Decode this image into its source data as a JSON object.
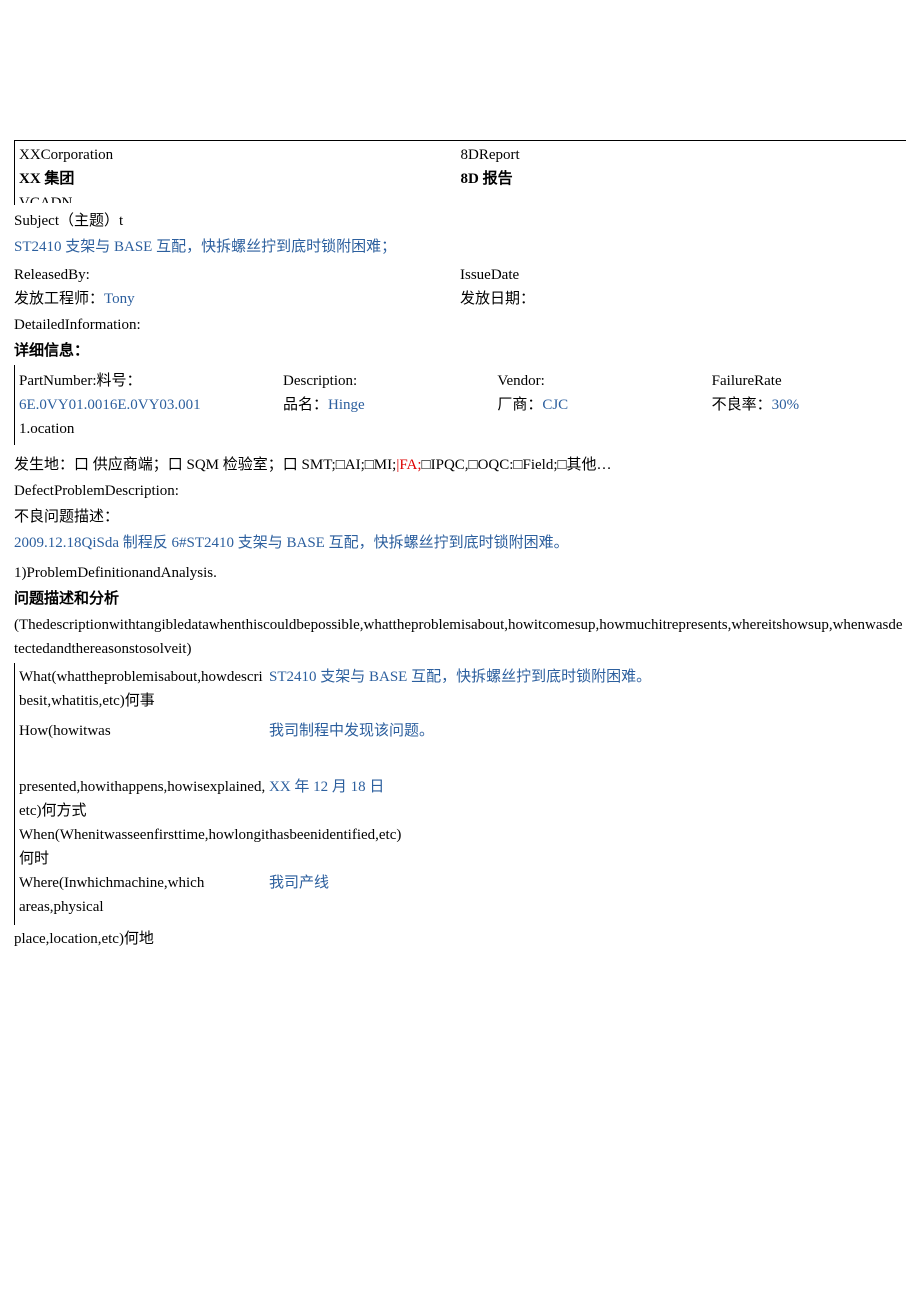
{
  "header": {
    "corp_en": "XXCorporation",
    "report_en": "8DReport",
    "corp_cn": "XX 集团",
    "report_cn": "8D 报告",
    "truncated": "VCADN"
  },
  "subject": {
    "label": "Subject（主题）t",
    "value": "ST2410 支架与 BASE 互配，快拆螺丝拧到底时锁附困难；"
  },
  "release": {
    "by_label_en": "ReleasedBy:",
    "by_label_cn": "发放工程师：",
    "by_value": "Tony",
    "date_label_en": "IssueDate",
    "date_label_cn": "发放日期：",
    "date_value": ""
  },
  "detail_header": {
    "en": "DetailedInformation:",
    "cn": "详细信息："
  },
  "details": {
    "part_label": "PartNumber:料号：",
    "part_value": "6E.0VY01.0016E.0VY03.001",
    "location_label": "1.ocation",
    "desc_label": "Description:",
    "desc_label_cn": "品名：",
    "desc_value": "Hinge",
    "vendor_label": "Vendor:",
    "vendor_label_cn": "厂商：",
    "vendor_value": "CJC",
    "rate_label": "FailureRate",
    "rate_label_cn": "不良率：",
    "rate_value": "30%"
  },
  "location_line": {
    "prefix": "发生地：口 供应商端；口 SQM 检验室；口 SMT;□AI;□MI;",
    "fa": "|FA;",
    "suffix": "□IPQC,□OQC:□Field;□其他…"
  },
  "defect": {
    "label_en": "DefectProblemDescription:",
    "label_cn": "不良问题描述：",
    "value": "2009.12.18QiSda 制程反 6#ST2410 支架与 BASE 互配，快拆螺丝拧到底时锁附困难。"
  },
  "d1": {
    "title_en": "1)ProblemDefinitionandAnalysis.",
    "title_cn": "问题描述和分析",
    "note": "(Thedescriptionwithtangibledatawhenthiscouldbepossible,whattheproblemisabout,howitcomesup,howmuchitrepresents,whereitshowsup,whenwasdetectedandthereasonstosolveit)"
  },
  "wh": {
    "what_label": "What(whattheproblemisabout,howdescribesit,whatitis,etc)何事",
    "what_value": "ST2410 支架与 BASE 互配，快拆螺丝拧到底时锁附困难。",
    "how_label": "How(howitwas",
    "how_value": "我司制程中发现该问题。",
    "how_label2": "presented,howithappens,howisexplained,etc)何方式",
    "when_value": "XX 年 12 月 18 日",
    "when_label": "When(Whenitwasseenfirsttime,howlongithasbeenidentified,etc)",
    "when_label2": "何时",
    "where_label": "Where(Inwhichmachine,which",
    "where_value": "我司产线",
    "where_label2": "areas,physical",
    "where_label3": "place,location,etc)何地"
  }
}
